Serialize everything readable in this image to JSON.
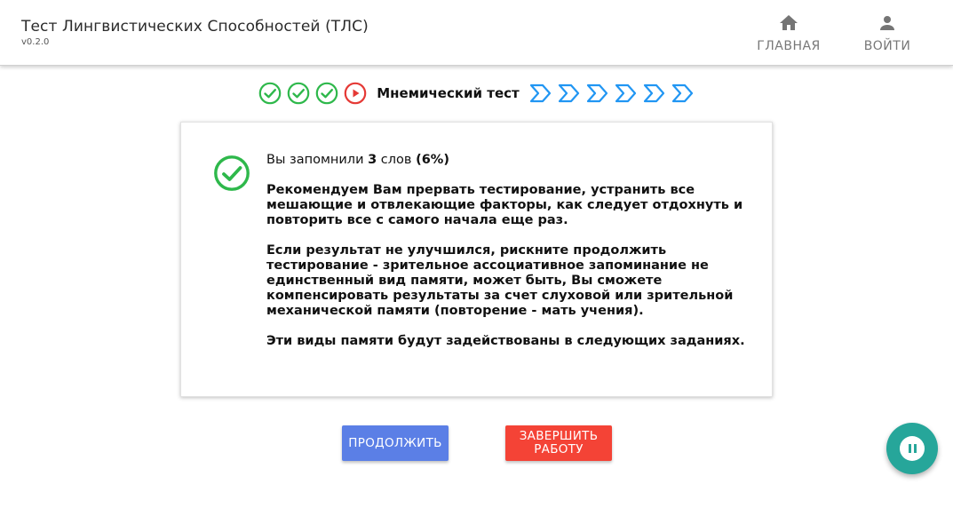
{
  "app": {
    "title": "Тест Лингвистических Способностей (ТЛС)",
    "version": "v0.2.0"
  },
  "nav": {
    "home_label": "ГЛАВНАЯ",
    "login_label": "ВОЙТИ",
    "home_icon": "home-icon",
    "login_icon": "person-icon"
  },
  "steps": {
    "completed_count": 3,
    "current_title": "Мнемический тест",
    "upcoming_count": 6,
    "colors": {
      "done": "#2eb84b",
      "current": "#e53935",
      "upcoming": "#2196f3"
    }
  },
  "result": {
    "intro_prefix": "Вы запомнили ",
    "words_count": "3",
    "words_suffix": " слов ",
    "percent": "(6%)",
    "paragraph1": "Рекомендуем Вам прервать тестирование, устранить все мешающие и отвлекающие факторы, как следует отдохнуть и повторить все с самого начала еще раз.",
    "paragraph2": "Если результат не улучшился, рискните продолжить тестирование - зрительное ассоциативное запоминание не единственный вид памяти, может быть, Вы сможете компенсировать результаты за счет слуховой или зрительной механической памяти (повторение - мать учения).",
    "paragraph3": "Эти виды памяти будут задействованы в следующих заданиях."
  },
  "actions": {
    "continue_label": "ПРОДОЛЖИТЬ",
    "finish_label": "ЗАВЕРШИТЬ РАБОТУ",
    "continue_color": "#5b7fe6",
    "finish_color": "#f44336"
  },
  "fab": {
    "icon": "pause-icon",
    "color": "#26a69a"
  }
}
